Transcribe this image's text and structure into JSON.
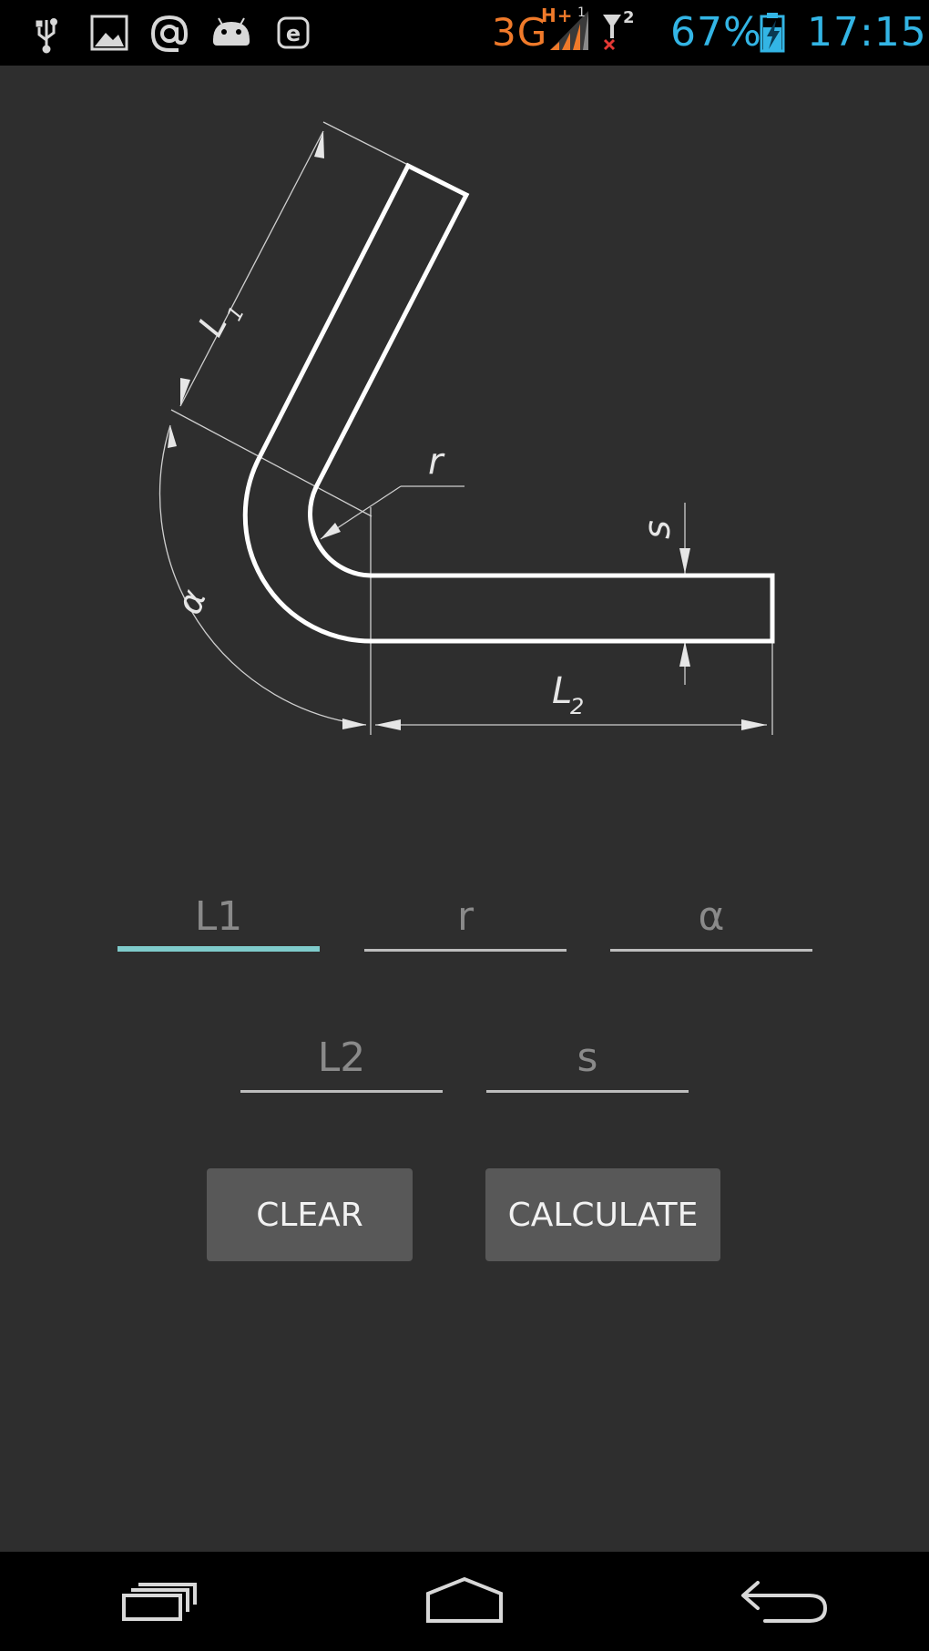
{
  "status_bar": {
    "network": "3G",
    "network_sub": "H+",
    "sim1_index": "1",
    "sim2_index": "2",
    "battery_percent": "67%",
    "time": "17:15",
    "icons": [
      "usb-icon",
      "image-icon",
      "at-email-icon",
      "android-icon",
      "e-icon",
      "signal-icon",
      "no-signal-icon",
      "battery-charging-icon"
    ],
    "colors": {
      "network": "#f07a2a",
      "battery": "#33b5e5",
      "time": "#33b5e5",
      "icon": "#d8d8d8",
      "x_mark": "#e53935"
    }
  },
  "diagram": {
    "label_l1": "L",
    "label_l1_sub": "1",
    "label_r": "r",
    "label_s": "s",
    "label_alpha": "α",
    "label_l2": "L",
    "label_l2_sub": "2"
  },
  "form": {
    "l1": {
      "placeholder": "L1",
      "value": ""
    },
    "r": {
      "placeholder": "r",
      "value": ""
    },
    "alpha": {
      "placeholder": "α",
      "value": ""
    },
    "l2": {
      "placeholder": "L2",
      "value": ""
    },
    "s": {
      "placeholder": "s",
      "value": ""
    },
    "active_color": "#7fcbcb"
  },
  "buttons": {
    "clear": "CLEAR",
    "calculate": "CALCULATE"
  },
  "nav_bar": {
    "icons": [
      "recent-apps-icon",
      "home-icon",
      "back-icon"
    ]
  }
}
